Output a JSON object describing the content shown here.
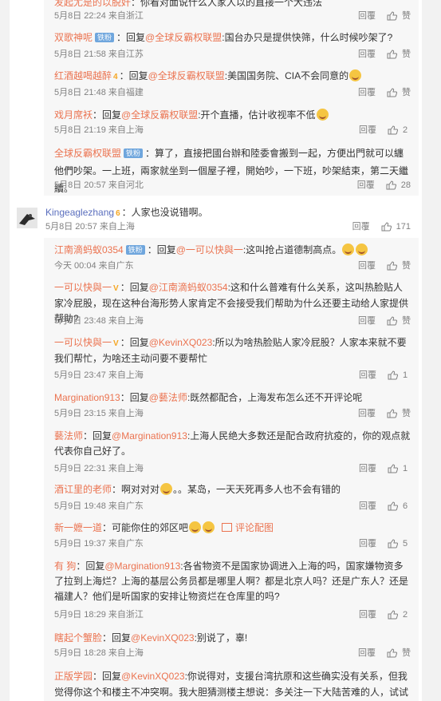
{
  "badges": {
    "iron": "铁粉"
  },
  "actions": {
    "reply": "回覆"
  },
  "comments": [
    {
      "name": "发起尤是的以脱奸",
      "prefix": "",
      "text": "你看对面说什么人家人以的直接一个大违法",
      "meta": "5月8日 22:24 来自浙江",
      "likes": "赞"
    },
    {
      "name": "双歌神呢",
      "badge": true,
      "prefix": "：回复",
      "mention": "@全球反霸权联盟",
      "text": ":国台办只是提供快筛，什么时候吵架了?",
      "meta": "5月8日 21:58 来自江苏",
      "likes": "赞"
    },
    {
      "name": "红酒越喝越醉",
      "vip": "4",
      "prefix": "：回复",
      "mention": "@全球反霸权联盟",
      "text": ":美国国务院、CIA不会同意的",
      "emoji": true,
      "meta": "5月8日 21:48 来自福建",
      "likes": "赞"
    },
    {
      "name": "戏月席袄",
      "prefix": "：回复",
      "mention": "@全球反霸权联盟",
      "text": ":开个直播，估计收视率不低",
      "emoji": true,
      "meta": "5月8日 21:19 来自上海",
      "likes": "2"
    },
    {
      "name": "全球反霸权联盟",
      "badge": true,
      "prefix": "：",
      "text": "算了，直接把國台辦和陸委會搬到一起，方便出門就可以纏他們吵架。一上班，兩家就坐到一個屋子裡，開始吵，一下班，吵架結束，第二天繼續。",
      "meta": "5月8日 20:57 来自河北",
      "likes": "28"
    }
  ],
  "top": {
    "name": "Kingeaglezhang",
    "vip": "6",
    "text": "：人家也没说错啊。",
    "meta": "5月8日 20:57 来自上海",
    "likes": "171"
  },
  "replies": [
    {
      "name": "江南滴蚂蚁0354",
      "badge": true,
      "prefix": "：回复",
      "mention": "@一可以快與一",
      "text": ":这叫抢占道德制高点。",
      "emoji2": true,
      "meta": "今天 00:04 来自广东",
      "likes": "赞"
    },
    {
      "name": "一可以快與一",
      "vip": "V",
      "prefix": "：回复",
      "mention": "@江南滴蚂蚁0354",
      "text": ":这和什么普难有什么关系，这叫热脸贴人家冷屁股，现在这种台海形势人家肯定不会接受我们帮助为什么还要主动给人家提供帮助?",
      "meta": "5月9日 23:48 来自上海",
      "likes": "赞"
    },
    {
      "name": "一可以快與一",
      "vip": "V",
      "prefix": "：回复",
      "mention": "@KevinXQ023",
      "text": ":所以为啥热脸贴人家冷屁股？人家本来就不要我们帮忙，为啥还主动问要不要帮忙",
      "meta": "5月9日 23:47 来自上海",
      "likes": "1"
    },
    {
      "name": "Margination913",
      "prefix": "：回复",
      "mention": "@藝法师",
      "text": ":既然都配合，上海发布怎么还不开评论呢",
      "meta": "5月9日 23:15 来自上海",
      "likes": "赞"
    },
    {
      "name": "藝法师",
      "prefix": "：回复",
      "mention": "@Margination913",
      "text": ":上海人民绝大多数还是配合政府抗疫的，你的观点就代表你自己好了。",
      "meta": "5月9日 22:31 来自上海",
      "likes": "1"
    },
    {
      "name": "酒讧里的老师",
      "prefix": "：",
      "text": "啊对对对",
      "emoji": true,
      "text2": "。。某岛，一天天死再多人也不会有错的",
      "meta": "5月9日 19:48 来自广东",
      "likes": "6"
    },
    {
      "name": "新一嬷一道",
      "prefix": "：",
      "text": "可能你住的郊区吧",
      "emoji2": true,
      "imglink": "评论配图",
      "meta": "5月9日 19:37 来自广东",
      "likes": "5"
    },
    {
      "name": "有 狗",
      "prefix": "：回复",
      "mention": "@Margination913",
      "text": ":各省物资不是国家协调进入上海的吗，国家嫌物资多了拉到上海烂？上海的基层公务员都是哪里人啊？都是北京人吗？还是广东人？还是福建人？他们是听国家的安排让物资烂在仓库里的吗?",
      "meta": "5月9日 18:29 来自浙江",
      "likes": "2"
    },
    {
      "name": "瞎起个蟹脸",
      "prefix": "：回复",
      "mention": "@KevinXQ023",
      "text": ":别说了，辜!",
      "meta": "5月9日 18:28 来自上海",
      "likes": "赞"
    },
    {
      "name": "正版学园",
      "prefix": "：回复",
      "mention": "@KevinXQ023",
      "text": ":你说得对，支援台湾抗原和这些确实没有关系，但我觉得你这个和楼主不冲突啊。我大胆猜测楼主想说：多关注一下大陆苦难的人，试试看能不能解决大陆",
      "meta": "",
      "likes": ""
    }
  ]
}
